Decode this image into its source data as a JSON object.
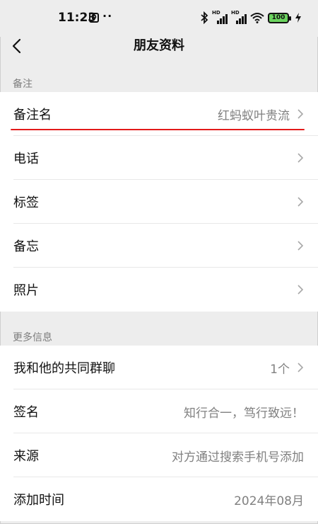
{
  "status_bar": {
    "time": "11:23",
    "app_icon_glyph": "D",
    "more_dots": "··",
    "signal_label_1": "HD",
    "signal_label_2": "HD",
    "battery": "100"
  },
  "nav": {
    "title": "朋友资料",
    "back_icon": "chevron-left-icon"
  },
  "sections": {
    "remark_header": "备注",
    "more_info_header": "更多信息"
  },
  "remark_rows": [
    {
      "label": "备注名",
      "value": "红蚂蚁叶贵流"
    },
    {
      "label": "电话",
      "value": ""
    },
    {
      "label": "标签",
      "value": ""
    },
    {
      "label": "备忘",
      "value": ""
    },
    {
      "label": "照片",
      "value": ""
    }
  ],
  "info_rows": [
    {
      "label": "我和他的共同群聊",
      "value": "1个"
    },
    {
      "label": "签名",
      "value": "知行合一，笃行致远！"
    },
    {
      "label": "来源",
      "value": "对方通过搜索手机号添加"
    },
    {
      "label": "添加时间",
      "value": "2024年08月"
    }
  ],
  "colors": {
    "background": "#ededed",
    "annotation_underline": "#e31b1b",
    "battery_fill": "#6bd35f"
  }
}
